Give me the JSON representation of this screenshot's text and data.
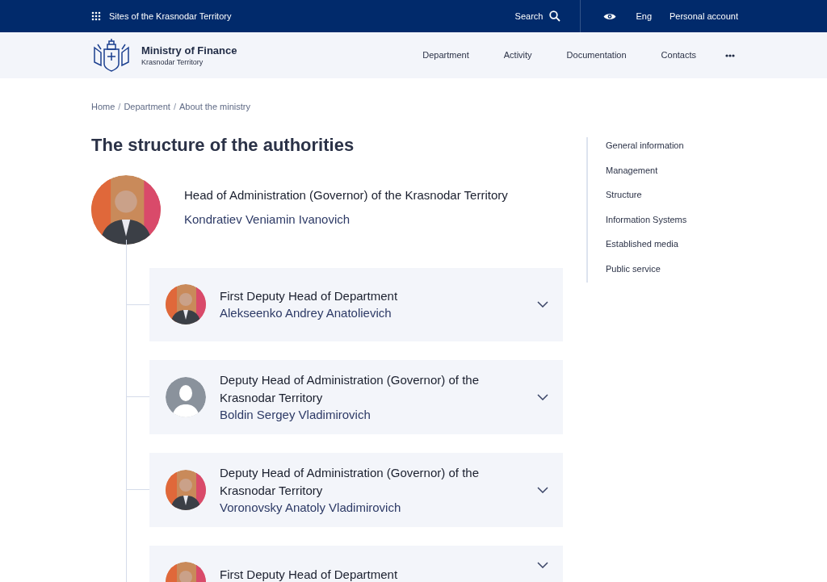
{
  "top_bar": {
    "sites_link": "Sites of the Krasnodar Territory",
    "search": "Search",
    "language": "Eng",
    "account": "Personal account"
  },
  "header": {
    "title": "Ministry of Finance",
    "subtitle": "Krasnodar Territory",
    "nav": [
      "Department",
      "Activity",
      "Documentation",
      "Contacts"
    ]
  },
  "breadcrumbs": [
    {
      "kind": "link",
      "text": "Home"
    },
    {
      "kind": "separator",
      "text": "/"
    },
    {
      "kind": "link",
      "text": "Department"
    },
    {
      "kind": "separator",
      "text": "/"
    },
    {
      "kind": "link",
      "text": "About the ministry"
    }
  ],
  "page_title": "The structure of the authorities",
  "head": {
    "position": "Head of Administration (Governor) of the Krasnodar Territory",
    "name": "Kondratiev Veniamin Ivanovich",
    "has_photo": true
  },
  "members": [
    {
      "position": "First Deputy Head of Department",
      "name": "Alekseenko Andrey Anatolievich",
      "has_photo": true,
      "expanded": false
    },
    {
      "position": "Deputy Head of Administration (Governor) of the Krasnodar Territory",
      "name": "Boldin Sergey Vladimirovich",
      "has_photo": false,
      "expanded": false
    },
    {
      "position": "Deputy Head of Administration (Governor) of the Krasnodar Territory",
      "name": "Voronovsky Anatoly Vladimirovich",
      "has_photo": true,
      "expanded": false
    },
    {
      "position": "First Deputy Head of Department",
      "has_photo": true,
      "expanded": false
    }
  ],
  "side_nav": [
    "General information",
    "Management",
    "Structure",
    "Information Systems",
    "Established media",
    "Public service"
  ]
}
